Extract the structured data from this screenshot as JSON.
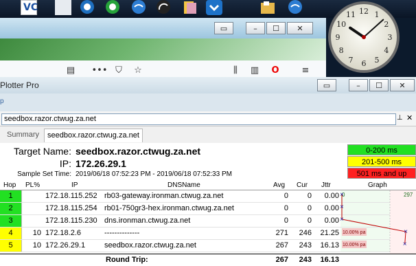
{
  "taskbar": {
    "icons": [
      "vlc-icon",
      "blank-doc-icon",
      "ie-icon",
      "green-app-icon",
      "wifi-icon",
      "speed-icon",
      "files-icon",
      "download-icon",
      "folder-icon",
      "wifi-icon-2"
    ],
    "vlc_text": "VC"
  },
  "browser": {
    "titlebar_buttons": [
      "▭",
      "–",
      "☐",
      "✕"
    ],
    "toolbar_icons": [
      "reader-icon",
      "more-icon",
      "pocket-icon",
      "star-icon",
      "library-icon",
      "sidebar-icon",
      "opera-icon",
      "menu-icon"
    ],
    "more_glyph": "•••",
    "star_glyph": "☆"
  },
  "pingplotter": {
    "title": "Plotter Pro",
    "strip_letter": "p",
    "titlebar_buttons": [
      "▭",
      "–",
      "☐",
      "✕"
    ],
    "target_input": "seedbox.razor.ctwug.za.net",
    "pin_glyph": "⊥",
    "close_glyph": "✕",
    "tabs": {
      "summary": "Summary",
      "target": "seedbox.razor.ctwug.za.net"
    },
    "summary": {
      "target_name_label": "Target Name:",
      "target_name_value": "seedbox.razor.ctwug.za.net",
      "ip_label": "IP:",
      "ip_value": "172.26.29.1",
      "sample_label": "Sample Set Time:",
      "sample_value": "2019/06/18 07:52:23 PM - 2019/06/18 07:52:33 PM"
    },
    "legend": [
      {
        "label": "0-200 ms",
        "color": "#22e022"
      },
      {
        "label": "201-500 ms",
        "color": "#ffff00"
      },
      {
        "label": "501 ms and up",
        "color": "#ff2020"
      }
    ],
    "table": {
      "headers": {
        "hop": "Hop",
        "pl": "PL%",
        "ip": "IP",
        "dns": "DNSName",
        "avg": "Avg",
        "cur": "Cur",
        "jttr": "Jttr",
        "graph": "Graph"
      },
      "rows": [
        {
          "hop": "1",
          "pl": "",
          "ip": "172.18.115.252",
          "dns": "rb03-gateway.ironman.ctwug.za.net",
          "avg": "0",
          "cur": "0",
          "jttr": "0.00",
          "color": "#22e022"
        },
        {
          "hop": "2",
          "pl": "",
          "ip": "172.18.115.254",
          "dns": "rb01-750gr3-hex.ironman.ctwug.za.net",
          "avg": "0",
          "cur": "0",
          "jttr": "0.00",
          "color": "#22e022"
        },
        {
          "hop": "3",
          "pl": "",
          "ip": "172.18.115.230",
          "dns": "dns.ironman.ctwug.za.net",
          "avg": "0",
          "cur": "0",
          "jttr": "0.00",
          "color": "#22e022"
        },
        {
          "hop": "4",
          "pl": "10",
          "ip": "172.18.2.6",
          "dns": "--------------",
          "avg": "271",
          "cur": "246",
          "jttr": "21.25",
          "color": "#ffff00"
        },
        {
          "hop": "5",
          "pl": "10",
          "ip": "172.26.29.1",
          "dns": "seedbox.razor.ctwug.za.net",
          "avg": "267",
          "cur": "243",
          "jttr": "16.13",
          "color": "#ffff00"
        }
      ],
      "roundtrip": {
        "label": "Round Trip:",
        "avg": "267",
        "cur": "243",
        "jttr": "16.13"
      }
    },
    "graph": {
      "scale_min": "0",
      "scale_max": "297",
      "loss_label": "10.00% pa",
      "marker": "×"
    }
  },
  "clock": {
    "hour": 10,
    "minute": 8
  }
}
